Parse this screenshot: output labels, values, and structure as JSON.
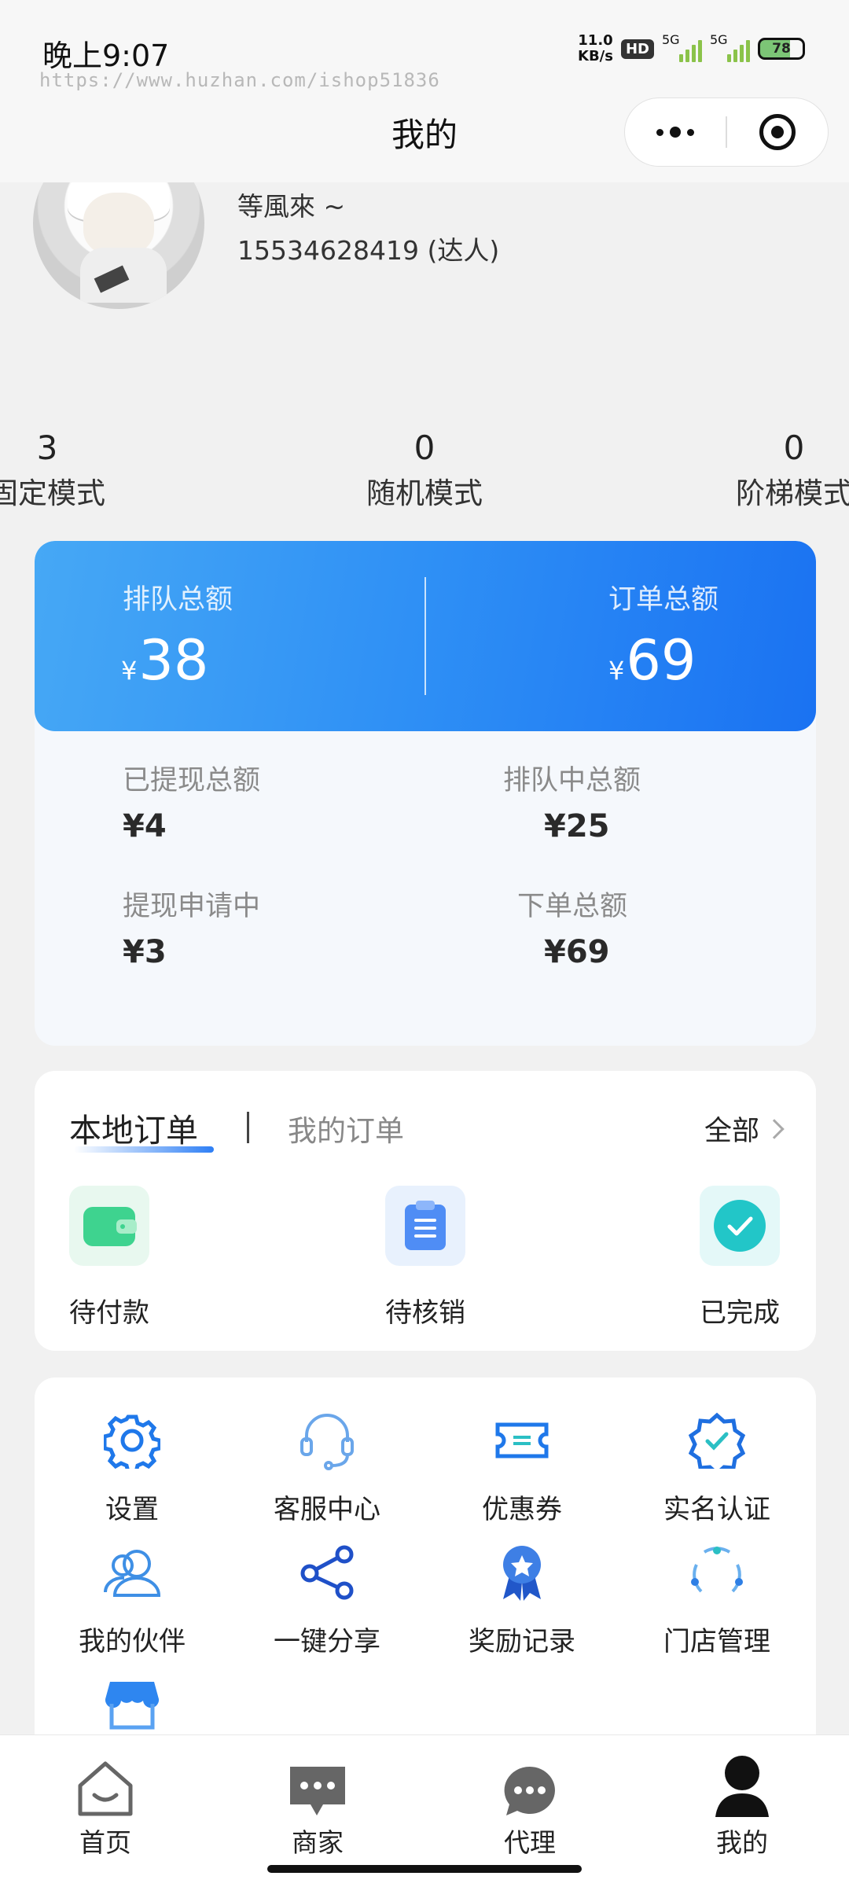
{
  "status": {
    "time": "晚上9:07",
    "speed_value": "11.0",
    "speed_unit": "KB/s",
    "hd": "HD",
    "sig1": "5G",
    "sig2": "5G",
    "battery": "78"
  },
  "watermark": "https://www.huzhan.com/ishop51836",
  "nav": {
    "title": "我的"
  },
  "user": {
    "name": "等風來 ~",
    "phone": "15534628419 (达人)"
  },
  "modes": [
    {
      "count": "3",
      "label": "固定模式"
    },
    {
      "count": "0",
      "label": "随机模式"
    },
    {
      "count": "0",
      "label": "阶梯模式"
    }
  ],
  "totals": {
    "queue_total_label": "排队总额",
    "queue_total_value": "38",
    "order_total_label": "订单总额",
    "order_total_value": "69",
    "currency": "¥",
    "withdrawn_label": "已提现总额",
    "withdrawn_value": "¥4",
    "queuing_label": "排队中总额",
    "queuing_value": "¥25",
    "withdraw_pending_label": "提现申请中",
    "withdraw_pending_value": "¥3",
    "placed_label": "下单总额",
    "placed_value": "¥69"
  },
  "orders": {
    "tab_local": "本地订单",
    "tab_mine": "我的订单",
    "all": "全部",
    "items": [
      {
        "label": "待付款",
        "icon": "wallet-icon"
      },
      {
        "label": "待核销",
        "icon": "clipboard-icon"
      },
      {
        "label": "已完成",
        "icon": "check-circle-icon"
      }
    ]
  },
  "tools": [
    {
      "label": "设置",
      "icon": "gear-icon"
    },
    {
      "label": "客服中心",
      "icon": "headset-icon"
    },
    {
      "label": "优惠券",
      "icon": "ticket-icon"
    },
    {
      "label": "实名认证",
      "icon": "verified-badge-icon"
    },
    {
      "label": "我的伙伴",
      "icon": "partners-icon"
    },
    {
      "label": "一键分享",
      "icon": "share-icon"
    },
    {
      "label": "奖励记录",
      "icon": "award-icon"
    },
    {
      "label": "门店管理",
      "icon": "store-manage-icon"
    },
    {
      "label": "",
      "icon": "shop-icon"
    }
  ],
  "tabbar": [
    {
      "label": "首页",
      "icon": "home-icon"
    },
    {
      "label": "商家",
      "icon": "merchant-chat-icon"
    },
    {
      "label": "代理",
      "icon": "agent-chat-icon"
    },
    {
      "label": "我的",
      "icon": "person-icon"
    }
  ],
  "colors": {
    "accent": "#1a72f2",
    "accent_light": "#46a8f5",
    "green": "#3ed38f",
    "teal": "#22c6c8"
  }
}
